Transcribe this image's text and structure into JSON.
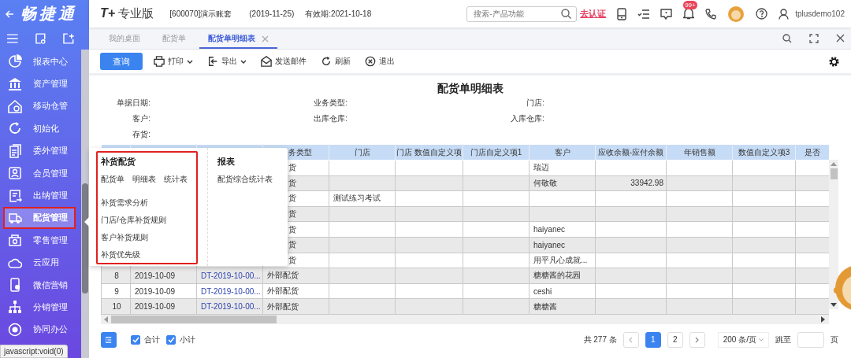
{
  "sidebar": {
    "logo": "畅捷通",
    "items": [
      {
        "label": "报表中心",
        "selected": false,
        "highlighted": false
      },
      {
        "label": "资产管理",
        "selected": false,
        "highlighted": false
      },
      {
        "label": "移动仓管",
        "selected": false,
        "highlighted": false
      },
      {
        "label": "初始化",
        "selected": false,
        "highlighted": false
      },
      {
        "label": "委外管理",
        "selected": false,
        "highlighted": false
      },
      {
        "label": "会员管理",
        "selected": false,
        "highlighted": false
      },
      {
        "label": "出纳管理",
        "selected": false,
        "highlighted": false
      },
      {
        "label": "配货管理",
        "selected": true,
        "highlighted": true
      },
      {
        "label": "零售管理",
        "selected": false,
        "highlighted": false
      },
      {
        "label": "云应用",
        "selected": false,
        "highlighted": false
      },
      {
        "label": "微信营销",
        "selected": false,
        "highlighted": false
      },
      {
        "label": "分销管理",
        "selected": false,
        "highlighted": false
      },
      {
        "label": "协同办公",
        "selected": false,
        "highlighted": false
      }
    ]
  },
  "status_tip": "javascript:void(0)",
  "header": {
    "logo_mark": "T+",
    "product": "专业版",
    "account": "[600070]演示账套",
    "date": "(2019-11-25)",
    "validity": "有效期:2021-10-18",
    "search": {
      "placeholder": "搜索-产品功能"
    },
    "verify_link": "去认证",
    "notification_badge": "99+",
    "user": "tplusdemo102"
  },
  "tabs": [
    {
      "label": "我的桌面",
      "selected": false,
      "closable": false
    },
    {
      "label": "配货单",
      "selected": false,
      "closable": false
    },
    {
      "label": "配货单明细表",
      "selected": true,
      "closable": true
    }
  ],
  "toolbar": {
    "primary": "查询",
    "actions": [
      {
        "label": "打印",
        "kind": "print",
        "dropdown": true
      },
      {
        "label": "导出",
        "kind": "export",
        "dropdown": true
      },
      {
        "label": "发送邮件",
        "kind": "mail",
        "dropdown": false
      },
      {
        "label": "刷新",
        "kind": "refresh",
        "dropdown": false
      },
      {
        "label": "退出",
        "kind": "exit",
        "dropdown": false
      }
    ]
  },
  "report": {
    "title": "配货单明细表",
    "filters": [
      "单据日期:",
      "业务类型:",
      "门店:",
      "客户:",
      "出库仓库:",
      "入库仓库:",
      "存货:"
    ]
  },
  "table": {
    "columns": [
      null,
      null,
      null,
      "务类型",
      "门店",
      "门店 数值自定义项",
      "门店自定义项1",
      "客户",
      "应收余额-应付余额",
      "年销售额",
      "数值自定义项3",
      "是否"
    ],
    "rows": [
      [
        null,
        null,
        null,
        "货",
        null,
        null,
        null,
        "瑞迈",
        null,
        null,
        null,
        null
      ],
      [
        null,
        null,
        null,
        "货",
        null,
        null,
        null,
        "何敬敬",
        "33942.98",
        null,
        null,
        null
      ],
      [
        null,
        null,
        null,
        "货",
        "测试练习考试",
        null,
        null,
        null,
        null,
        null,
        null,
        null
      ],
      [
        null,
        null,
        null,
        "货",
        null,
        null,
        null,
        null,
        null,
        null,
        null,
        null
      ],
      [
        null,
        null,
        null,
        "货",
        null,
        null,
        null,
        "haiyanec",
        null,
        null,
        null,
        null
      ],
      [
        null,
        null,
        null,
        "货",
        null,
        null,
        null,
        "haiyanec",
        null,
        null,
        null,
        null
      ],
      [
        null,
        null,
        null,
        "货",
        null,
        null,
        null,
        "用平凡心成就...",
        null,
        null,
        null,
        null
      ],
      [
        "8",
        "2019-10-09",
        "DT-2019-10-00...",
        "外部配货",
        null,
        null,
        null,
        "糖糖酱的花园",
        null,
        null,
        null,
        null
      ],
      [
        "9",
        "2019-10-09",
        "DT-2019-10-00...",
        "外部配货",
        null,
        null,
        null,
        "ceshi",
        null,
        null,
        null,
        null
      ],
      [
        "10",
        "2019-10-09",
        "DT-2019-10-00...",
        "外部配货",
        null,
        null,
        null,
        "糖糖酱",
        null,
        null,
        null,
        null
      ]
    ]
  },
  "popup": {
    "sections": [
      {
        "title": "补货配货",
        "highlighted": true,
        "links": [
          "配货单",
          "明细表",
          "统计表"
        ],
        "items": [
          "补货需求分析",
          "门店/仓库补货规则",
          "客户补货规则",
          "补货优先级"
        ]
      },
      {
        "title": "报表",
        "highlighted": false,
        "links": [
          "配货综合统计表"
        ]
      }
    ]
  },
  "footer": {
    "checkboxes": [
      {
        "label": "合计",
        "checked": true
      },
      {
        "label": "小计",
        "checked": true
      }
    ],
    "total": "共 277 条",
    "pages": [
      {
        "label": "1",
        "selected": true
      },
      {
        "label": "2",
        "selected": false
      }
    ],
    "page_size": "200 条/页",
    "jump_label": "跳至",
    "page_unit": "页"
  }
}
